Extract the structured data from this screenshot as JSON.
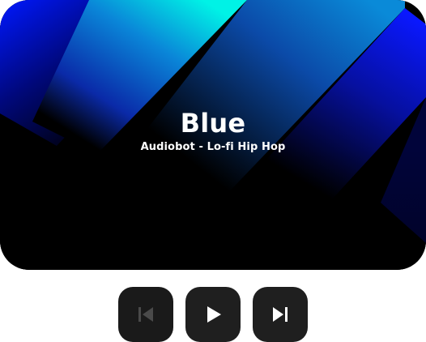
{
  "track": {
    "title": "Blue",
    "subtitle": "Audiobot - Lo-fi Hip Hop"
  },
  "controls": {
    "previous": {
      "icon": "skip-previous-icon",
      "enabled": false
    },
    "play": {
      "icon": "play-icon",
      "enabled": true
    },
    "next": {
      "icon": "skip-next-icon",
      "enabled": true
    }
  },
  "colors": {
    "artwork_background": "#000000",
    "accent_cyan": "#00f0e0",
    "accent_blue": "#0010e0",
    "button_background": "#1f1f1f",
    "icon_active": "#ffffff",
    "icon_disabled": "#4a4a4a"
  }
}
